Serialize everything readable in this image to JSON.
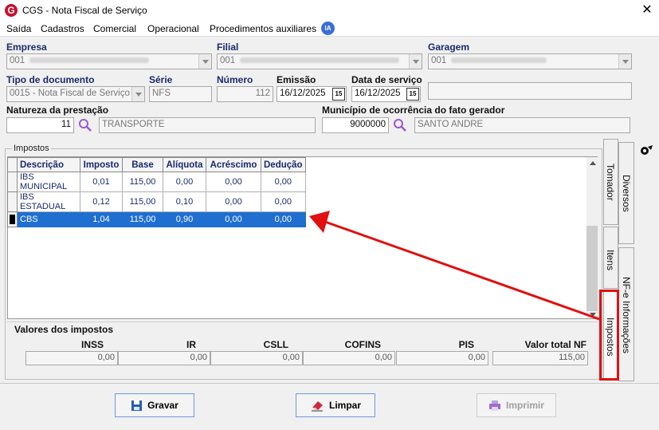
{
  "window": {
    "title": "CGS - Nota Fiscal de Serviço",
    "app_icon": "G",
    "close_symbol": "✕"
  },
  "menu": {
    "items": [
      "Saída",
      "Cadastros",
      "Comercial",
      "Operacional",
      "Procedimentos auxiliares"
    ],
    "ia_badge": "IA"
  },
  "form": {
    "empresa": {
      "label": "Empresa",
      "value": "001"
    },
    "filial": {
      "label": "Filial",
      "value": "001"
    },
    "garagem": {
      "label": "Garagem",
      "value": "001"
    },
    "tipo_documento": {
      "label": "Tipo de documento",
      "value": "0015 - Nota Fiscal de Serviço"
    },
    "serie": {
      "label": "Série",
      "value": "NFS"
    },
    "numero": {
      "label": "Número",
      "value": "112"
    },
    "emissao": {
      "label": "Emissão",
      "value": "16/12/2025"
    },
    "data_servico": {
      "label": "Data de serviço",
      "value": "16/12/2025"
    },
    "calendar_icon_text": "15",
    "natureza": {
      "label": "Natureza da prestação",
      "code": "11",
      "description": "TRANSPORTE"
    },
    "municipio": {
      "label": "Município de ocorrência do fato gerador",
      "code": "9000000",
      "description": "SANTO ANDRE"
    }
  },
  "impostos": {
    "group_title": "Impostos",
    "columns": [
      "Descrição",
      "Imposto",
      "Base",
      "Alíquota",
      "Acréscimo",
      "Dedução"
    ],
    "rows": [
      [
        "IBS MUNICIPAL",
        "0,01",
        "115,00",
        "0,00",
        "0,00",
        "0,00"
      ],
      [
        "IBS ESTADUAL",
        "0,12",
        "115,00",
        "0,10",
        "0,00",
        "0,00"
      ],
      [
        "CBS",
        "1,04",
        "115,00",
        "0,90",
        "0,00",
        "0,00"
      ]
    ],
    "selected_row": 2
  },
  "valores": {
    "title": "Valores dos impostos",
    "items": [
      {
        "label": "INSS",
        "value": "0,00"
      },
      {
        "label": "IR",
        "value": "0,00"
      },
      {
        "label": "CSLL",
        "value": "0,00"
      },
      {
        "label": "COFINS",
        "value": "0,00"
      },
      {
        "label": "PIS",
        "value": "0,00"
      },
      {
        "label": "Valor total NF",
        "value": "115,00"
      }
    ]
  },
  "tabs": {
    "inner": [
      "Tomador",
      "Itens",
      "Impostos"
    ],
    "outer": [
      "Diversos",
      "NF-e Informações"
    ],
    "active": "Impostos"
  },
  "buttons": {
    "gravar": "Gravar",
    "limpar": "Limpar",
    "imprimir": "Imprimir"
  },
  "colors": {
    "selection": "#1f6fd1",
    "label_blue": "#1a2a6c",
    "annotation_red": "#e01010",
    "accent_brand": "#c8102e"
  }
}
